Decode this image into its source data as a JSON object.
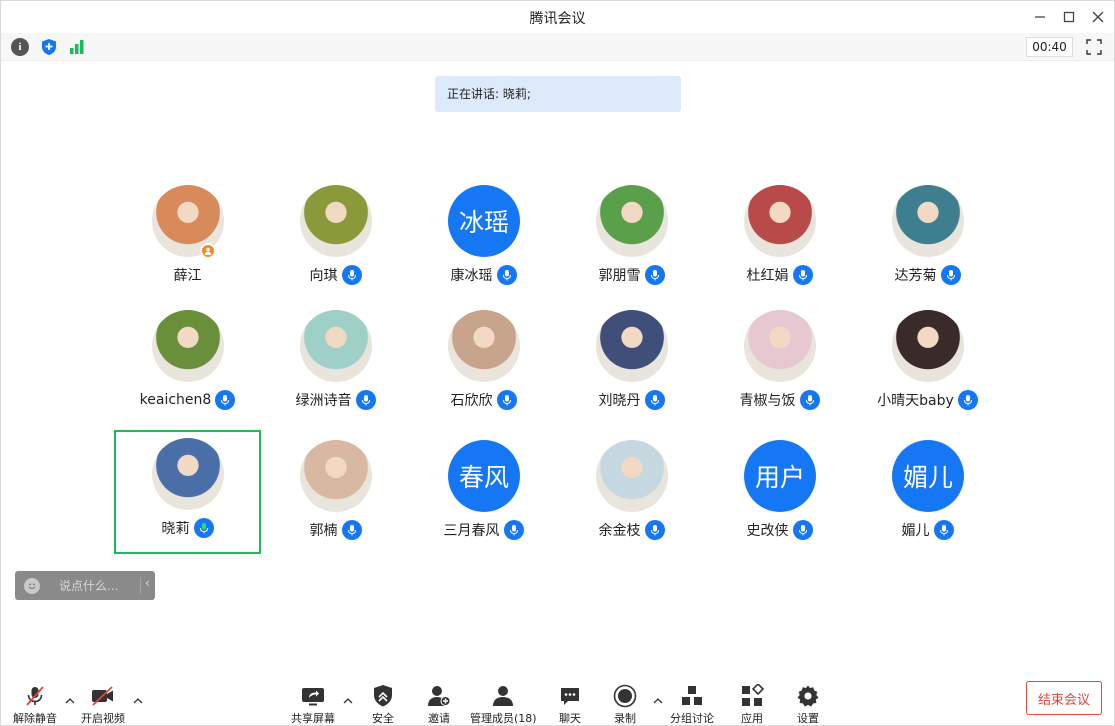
{
  "window": {
    "title": "腾讯会议"
  },
  "infobar": {
    "timer": "00:40"
  },
  "speaking": {
    "text": "正在讲话: 晓莉;"
  },
  "participants": [
    {
      "name": "薛江",
      "avatar": "photo",
      "color": "#d98a5b",
      "host": true
    },
    {
      "name": "向琪",
      "avatar": "photo",
      "color": "#8a9a3a"
    },
    {
      "name": "康冰瑶",
      "avatar": "text",
      "avatar_text": "冰瑶"
    },
    {
      "name": "郭朋雪",
      "avatar": "photo",
      "color": "#5aa04a"
    },
    {
      "name": "杜红娟",
      "avatar": "photo",
      "color": "#b84a4a"
    },
    {
      "name": "达芳菊",
      "avatar": "photo",
      "color": "#3d7f8f"
    },
    {
      "name": "keaichen8",
      "avatar": "photo",
      "color": "#6a8f3a"
    },
    {
      "name": "绿洲诗音",
      "avatar": "photo",
      "color": "#9fd0c8"
    },
    {
      "name": "石欣欣",
      "avatar": "photo",
      "color": "#c9a48c"
    },
    {
      "name": "刘晓丹",
      "avatar": "photo",
      "color": "#3f4f7a"
    },
    {
      "name": "青椒与饭",
      "avatar": "photo",
      "color": "#e8c8d0"
    },
    {
      "name": "小晴天baby",
      "avatar": "photo",
      "color": "#3a2a2a"
    },
    {
      "name": "晓莉",
      "avatar": "photo",
      "color": "#4a6fa8",
      "active": true
    },
    {
      "name": "郭楠",
      "avatar": "photo",
      "color": "#d8b8a0"
    },
    {
      "name": "三月春风",
      "avatar": "text",
      "avatar_text": "春风"
    },
    {
      "name": "余金枝",
      "avatar": "photo",
      "color": "#c5d8e0"
    },
    {
      "name": "史改侠",
      "avatar": "text",
      "avatar_text": "用户"
    },
    {
      "name": "媚儿",
      "avatar": "text",
      "avatar_text": "媚儿"
    }
  ],
  "chat": {
    "placeholder": "说点什么..."
  },
  "toolbar": {
    "unmute": "解除静音",
    "video": "开启视频",
    "share": "共享屏幕",
    "security": "安全",
    "invite": "邀请",
    "members": "管理成员(18)",
    "chat": "聊天",
    "record": "录制",
    "breakout": "分组讨论",
    "apps": "应用",
    "settings": "设置",
    "end": "结束会议"
  },
  "colors": {
    "accent": "#1677f5",
    "active_border": "#1fb95a",
    "end": "#e0463a"
  }
}
